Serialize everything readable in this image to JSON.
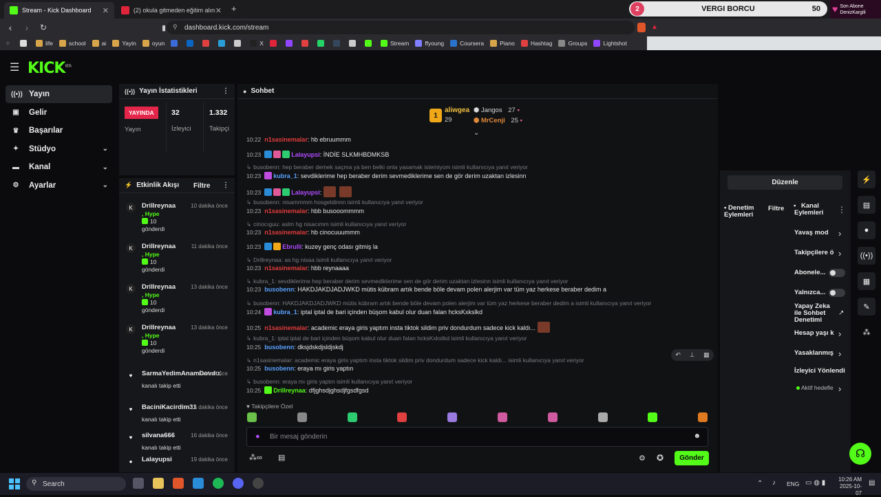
{
  "browser": {
    "tabs": [
      {
        "title": "Stream - Kick Dashboard",
        "color": "#53fc18"
      },
      {
        "title": "(2) okula gitmeden eğitim alınır mı s...",
        "color": "#e0243a"
      }
    ],
    "new_tab": "+",
    "url": "dashboard.kick.com/stream",
    "bookmarks": [
      {
        "label": "",
        "color": "#ddd"
      },
      {
        "label": "life",
        "color": "#d9a54a"
      },
      {
        "label": "school",
        "color": "#d9a54a"
      },
      {
        "label": "ai",
        "color": "#d9a54a"
      },
      {
        "label": "Yayin",
        "color": "#d9a54a"
      },
      {
        "label": "oyun",
        "color": "#d9a54a"
      },
      {
        "label": "",
        "color": "#3b6bd9"
      },
      {
        "label": "",
        "color": "#0a66c2"
      },
      {
        "label": "",
        "color": "#e04040"
      },
      {
        "label": "",
        "color": "#2a9fd6"
      },
      {
        "label": "",
        "color": "#cccccc"
      },
      {
        "label": "X",
        "color": "#222222"
      },
      {
        "label": "",
        "color": "#e0243a"
      },
      {
        "label": "",
        "color": "#9146ff"
      },
      {
        "label": "",
        "color": "#e04040"
      },
      {
        "label": "",
        "color": "#25d366"
      },
      {
        "label": "",
        "color": "#35465c"
      },
      {
        "label": "",
        "color": "#cccccc"
      },
      {
        "label": "",
        "color": "#53fc18"
      },
      {
        "label": "Stream",
        "color": "#53fc18"
      },
      {
        "label": "ffyoung",
        "color": "#8080ff"
      },
      {
        "label": "Coursera",
        "color": "#2a73cc"
      },
      {
        "label": "Piano",
        "color": "#d9a54a"
      },
      {
        "label": "Hashtag",
        "color": "#e04040"
      },
      {
        "label": "Groups",
        "color": "#888888"
      },
      {
        "label": "Lightshot",
        "color": "#9146ff"
      }
    ]
  },
  "overlay": {
    "goal_number": "2",
    "goal_title": "VERGI BORCU",
    "goal_count": "50",
    "sub_label": "Son Abone",
    "sub_name": "DenizKargili"
  },
  "app": {
    "logo": "KICK",
    "logo_tag": "BETA",
    "nav": [
      {
        "label": "Yayın",
        "icon": "broadcast-icon",
        "glyph": "((•))",
        "active": true,
        "chev": ""
      },
      {
        "label": "Gelir",
        "icon": "money-icon",
        "glyph": "▣",
        "active": false,
        "chev": ""
      },
      {
        "label": "Başarılar",
        "icon": "trophy-icon",
        "glyph": "♛",
        "active": false,
        "chev": ""
      },
      {
        "label": "Stüdyo",
        "icon": "studio-icon",
        "glyph": "✦",
        "active": false,
        "chev": "⌄"
      },
      {
        "label": "Kanal",
        "icon": "channel-icon",
        "glyph": "▬",
        "active": false,
        "chev": "⌄"
      },
      {
        "label": "Ayarlar",
        "icon": "settings-icon",
        "glyph": "⚙",
        "active": false,
        "chev": "⌄"
      }
    ]
  },
  "stats": {
    "title": "Yayın İstatistikleri",
    "status": "YAYINDA",
    "status_label": "Yayın",
    "viewers": "32",
    "viewers_label": "İzleyici",
    "followers": "1.332",
    "followers_label": "Takipçi"
  },
  "activity": {
    "title": "Etkinlik Akışı",
    "filter": "Filtre",
    "items": [
      {
        "name": "Drillreynaa",
        "time": "10 dakika önce",
        "line2": ", Hype",
        "line3": "10",
        "line4": "gönderdi",
        "kind": "kick"
      },
      {
        "name": "Drillreynaa",
        "time": "11 dakika önce",
        "line2": ", Hype",
        "line3": "10",
        "line4": "gönderdi",
        "kind": "kick"
      },
      {
        "name": "Drillreynaa",
        "time": "13 dakika önce",
        "line2": ", Hype",
        "line3": "10",
        "line4": "gönderdi",
        "kind": "kick"
      },
      {
        "name": "Drillreynaa",
        "time": "13 dakika önce",
        "line2": ", Hype",
        "line3": "10",
        "line4": "gönderdi",
        "kind": "kick"
      },
      {
        "name": "SarmaYedimAnamDovdu1",
        "time": "dakika önce",
        "line2": "",
        "line3": "kanalı takip etti",
        "line4": "",
        "kind": "follow"
      },
      {
        "name": "BaciniKacirdim31",
        "time": "16 dakika önce",
        "line2": "",
        "line3": "kanalı takip etti",
        "line4": "",
        "kind": "follow"
      },
      {
        "name": "silvana666",
        "time": "16 dakika önce",
        "line2": "",
        "line3": "kanalı takip etti",
        "line4": "",
        "kind": "follow"
      },
      {
        "name": "Lalayupsi",
        "time": "19 dakika önce",
        "line2": "",
        "line3": "",
        "line4": "",
        "kind": "other"
      }
    ]
  },
  "chat": {
    "title": "Sohbet",
    "leaderboard": {
      "first": {
        "name": "aliwgea",
        "count": "29",
        "rank": "1"
      },
      "second": {
        "name": "Jangos",
        "count": "27"
      },
      "third": {
        "name": "MrCenji",
        "count": "25"
      }
    },
    "lines": [
      {
        "type": "msg",
        "ts": "10:22",
        "user": "n1sasinemalar",
        "color": "#e03c3c",
        "text": ": hb ebruummm",
        "badges": []
      },
      {
        "type": "msg",
        "ts": "10:23",
        "user": "Lalayupsi",
        "color": "#b04cff",
        "text": ": İNDİE SLKMHBDMKSB",
        "badges": [
          "#2a8bd6",
          "#e05a9a",
          "#2ecc71"
        ]
      },
      {
        "type": "reply",
        "text": "busobenn: hep beraber demek saçma ya ben belki onla yasamak istemiyom isimli kullanıcıya yanıt veriyor"
      },
      {
        "type": "msg",
        "ts": "10:23",
        "user": "kubra_1",
        "color": "#5aa0ff",
        "text": ": sevdiklerime hep beraber derim sevmediklerime sen de gör derim uzaktan izlesinn",
        "badges": [
          "#c04ce0"
        ]
      },
      {
        "type": "msg",
        "ts": "10:23",
        "user": "Lalayupsi",
        "color": "#b04cff",
        "text": ":",
        "badges": [
          "#2a8bd6",
          "#e05a9a",
          "#2ecc71"
        ],
        "emotes": 2
      },
      {
        "type": "reply",
        "text": "busobenn: nisammmm hosgeldinnn isimli kullanıcıya yanıt veriyor"
      },
      {
        "type": "msg",
        "ts": "10:23",
        "user": "n1sasinemalar",
        "color": "#e03c3c",
        "text": ": hbb busooommmm",
        "badges": []
      },
      {
        "type": "reply",
        "text": "cinocıguu: aslm hg nisacımm isimli kullanıcıya yanıt veriyor"
      },
      {
        "type": "msg",
        "ts": "10:23",
        "user": "n1sasinemalar",
        "color": "#e03c3c",
        "text": ": hb cinocuuummm",
        "badges": []
      },
      {
        "type": "msg",
        "ts": "10:23",
        "user": "Ebrulli",
        "color": "#b04cff",
        "text": ": kuzey genç odası gitmiş la",
        "badges": [
          "#2a8bd6",
          "#f0a818"
        ]
      },
      {
        "type": "reply",
        "text": "Drillreynaa: as hg nisaa isimli kullanıcıya yanıt veriyor"
      },
      {
        "type": "msg",
        "ts": "10:23",
        "user": "n1sasinemalar",
        "color": "#e03c3c",
        "text": ": hbb reynaaaa",
        "badges": []
      },
      {
        "type": "reply",
        "text": "kubra_1: sevdiklerime hep beraber derim sevmediklerime sen de gör derim uzaktan izlesinn isimli kullanıcıya yanıt veriyor"
      },
      {
        "type": "msg",
        "ts": "10:23",
        "user": "busobenn",
        "color": "#5aa0ff",
        "text": ": HAKDJAKDJADJWKD mütis kübram artık bende böle devam polen alerjim var tüm yaz herkese beraber dedim a",
        "badges": []
      },
      {
        "type": "reply",
        "text": "busobenn: HAKDJAKDJADJWKD mütis kübram artık bende böle devam polen alerjim var tüm yaz herkese beraber dedim a isimli kullanıcıya yanıt veriyor"
      },
      {
        "type": "msg",
        "ts": "10:24",
        "user": "kubra_1",
        "color": "#5aa0ff",
        "text": ": iptal iptal de bari içinden büşom kabul olur duan falan hcksKxkslkd",
        "badges": [
          "#c04ce0"
        ]
      },
      {
        "type": "msg",
        "ts": "10:25",
        "user": "n1sasinemalar",
        "color": "#e03c3c",
        "text": ": academic eraya giris yaptım insta tiktok sildim priv dondurdum sadece kick kaldı...",
        "badges": [],
        "emotes": 1
      },
      {
        "type": "reply",
        "text": "kubra_1: iptal iptal de bari içinden büşom kabul olur duan falan hcksKxkslkd isimli kullanıcıya yanıt veriyor"
      },
      {
        "type": "msg",
        "ts": "10:25",
        "user": "busobenn",
        "color": "#5aa0ff",
        "text": ": dksjdskdjsldjskdj",
        "badges": []
      },
      {
        "type": "reply",
        "text": "n1sasinemalar: academic eraya giris yaptım insta tiktok sildim priv dondurdum sadece kick kaldı...     isimli kullanıcıya yanıt veriyor"
      },
      {
        "type": "msg",
        "ts": "10:25",
        "user": "busobenn",
        "color": "#5aa0ff",
        "text": ": eraya mı giris yaptın",
        "badges": []
      },
      {
        "type": "reply",
        "text": "busobenn: eraya mı giris yaptın isimli kullanıcıya yanıt veriyor"
      },
      {
        "type": "msg",
        "ts": "10:25",
        "user": "Drillreynaa",
        "color": "#53fc18",
        "text": ": dfjghsdjghsdjfgsdfgsd",
        "badges": [
          "#53fc18"
        ]
      }
    ],
    "followers_only": "Takipçilere Özel",
    "emote_colors": [
      "#6ac04a",
      "#888",
      "#2ecc71",
      "#e04040",
      "#9a7adf",
      "#d05aa0",
      "#d05aa0",
      "#aaa",
      "#53fc18",
      "#e07a20"
    ],
    "input_placeholder": "Bir mesaj gönderin",
    "send": "Gönder"
  },
  "right": {
    "edit": "Düzenle",
    "mod_actions": "Denetim Eylemleri",
    "filter": "Filtre",
    "channel_actions": "Kanal Eylemleri",
    "items": [
      {
        "label": "Yavaş mod",
        "control": "chev"
      },
      {
        "label": "Takipçilere ö",
        "control": "chev"
      },
      {
        "label": "Abonele...",
        "control": "toggle"
      },
      {
        "label": "Yalnızca...",
        "control": "toggle"
      },
      {
        "label": "Yapay Zeka ile Sohbet Denetimi",
        "control": "ext"
      },
      {
        "label": "Hesap yaşı k",
        "control": "chev"
      },
      {
        "label": "Yasaklanmış",
        "control": "chev"
      },
      {
        "label": "İzleyici Yönlendir",
        "control": "none"
      },
      {
        "label": "Aktif hedefle",
        "control": "chev"
      }
    ]
  },
  "taskbar": {
    "search": "Search",
    "lang": "ENG",
    "time": "10:26 AM",
    "date": "2025-10-07"
  }
}
